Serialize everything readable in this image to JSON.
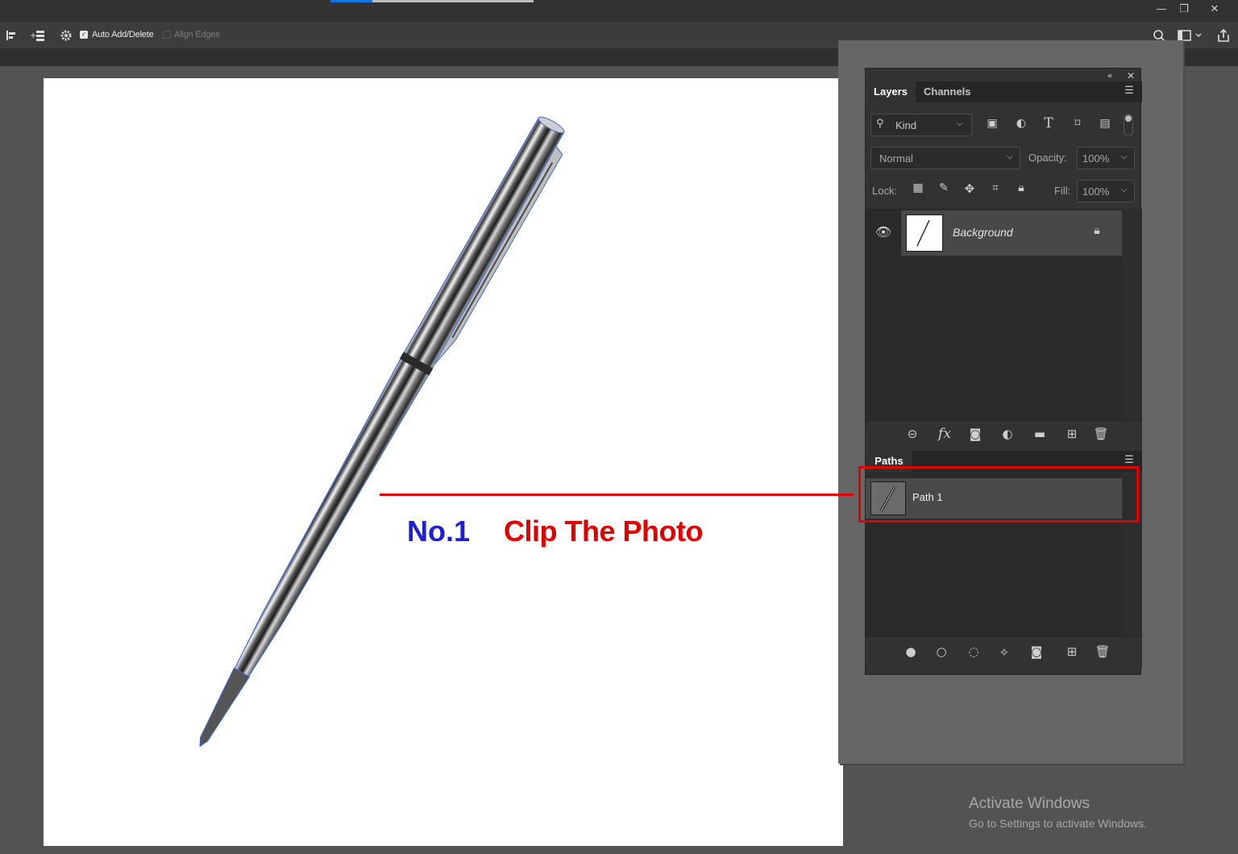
{
  "window": {
    "minimize": "—",
    "restore": "❐",
    "close": "✕"
  },
  "options_bar": {
    "auto_add_delete_label": "Auto Add/Delete",
    "auto_add_delete_checked": true,
    "align_edges_label": "Align Edges",
    "align_edges_checked": false
  },
  "layers_panel": {
    "tabs": [
      {
        "label": "Layers",
        "active": true
      },
      {
        "label": "Channels",
        "active": false
      }
    ],
    "filter_kind": "Kind",
    "blend_mode": "Normal",
    "opacity_label": "Opacity:",
    "opacity_value": "100%",
    "lock_label": "Lock:",
    "fill_label": "Fill:",
    "fill_value": "100%",
    "layers": [
      {
        "name": "Background",
        "visible": true,
        "locked": true
      }
    ]
  },
  "paths_panel": {
    "title": "Paths",
    "paths": [
      {
        "name": "Path 1",
        "selected": true
      }
    ]
  },
  "annotation": {
    "number": "No.1",
    "text": "Clip The Photo",
    "color": "#e00000",
    "number_color": "#1f1fd6"
  },
  "watermark": {
    "line1": "Activate Windows",
    "line2": "Go to Settings to activate Windows."
  }
}
